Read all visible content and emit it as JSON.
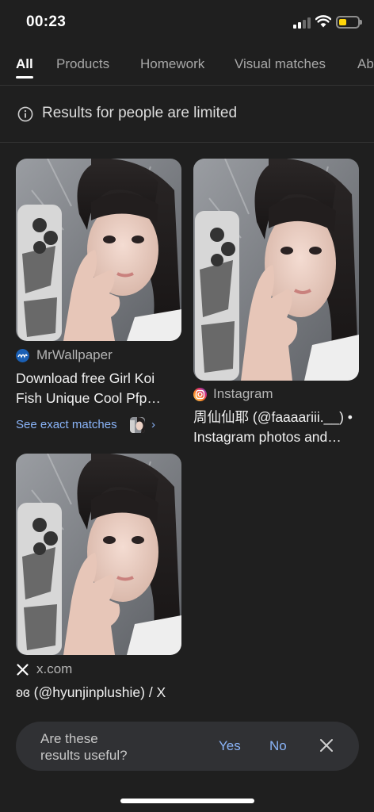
{
  "status_bar": {
    "time": "00:23"
  },
  "tabs": [
    {
      "label": "All",
      "active": true
    },
    {
      "label": "Products"
    },
    {
      "label": "Homework"
    },
    {
      "label": "Visual matches"
    },
    {
      "label": "Ab"
    }
  ],
  "notice": {
    "text": "Results for people are limited"
  },
  "results": [
    {
      "source": "MrWallpaper",
      "source_icon": "mrwallpaper-logo-icon",
      "title_line1": "Download free Girl Koi",
      "title_line2": "Fish Unique Cool Pfp…",
      "see_exact": "See exact matches",
      "chevron": "›"
    },
    {
      "source": "Instagram",
      "source_icon": "instagram-logo-icon",
      "title_line1": "周仙仙耶 (@faaaariii.__) •",
      "title_line2": "Instagram photos and…"
    },
    {
      "source": "x.com",
      "source_icon": "x-logo-icon",
      "title_line1": "ʚɞ (@hyunjinplushie) / X"
    }
  ],
  "feedback": {
    "question_line1": "Are these",
    "question_line2": "results useful?",
    "yes_label": "Yes",
    "no_label": "No"
  },
  "colors": {
    "background": "#1f1f1f",
    "link_blue": "#8ab4f8",
    "battery_yellow": "#ffd60a"
  }
}
